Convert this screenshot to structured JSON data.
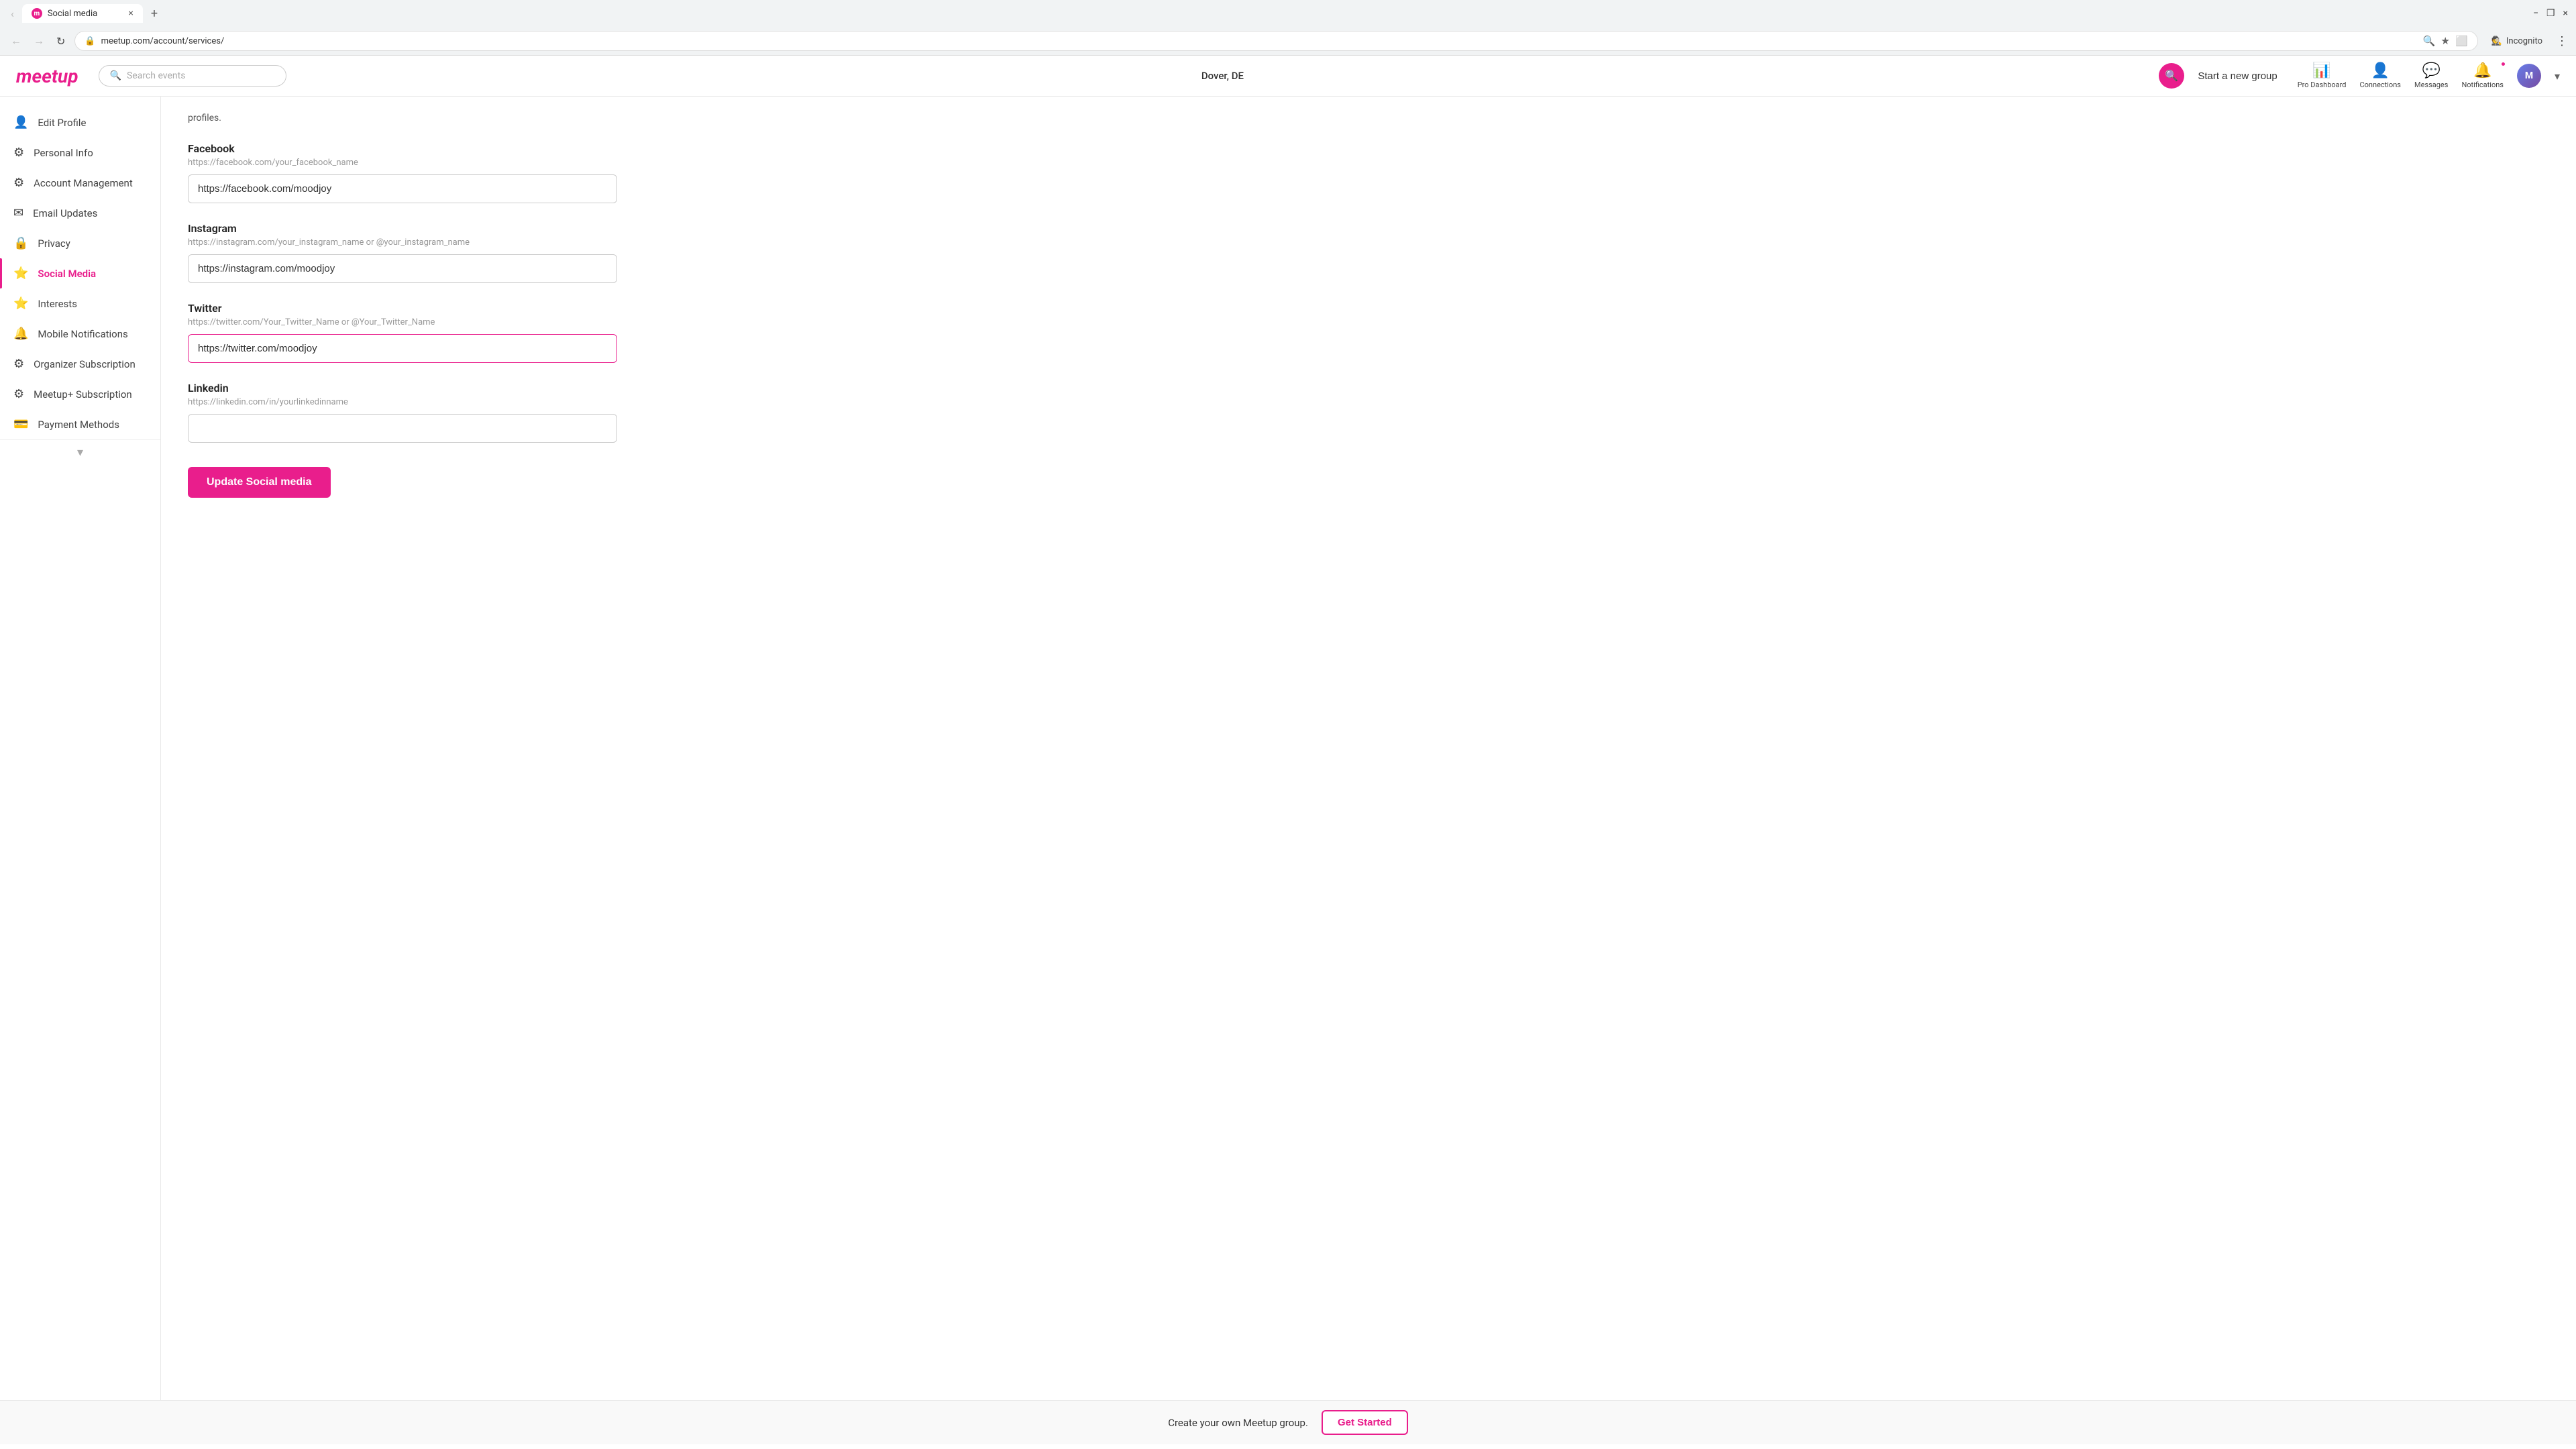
{
  "browser": {
    "tab_title": "Social media",
    "url": "meetup.com/account/services/",
    "tab_close": "×",
    "tab_new": "+",
    "nav_back": "←",
    "nav_forward": "→",
    "nav_refresh": "↻",
    "incognito_label": "Incognito",
    "window_minimize": "−",
    "window_restore": "❐",
    "window_close": "×"
  },
  "navbar": {
    "logo": "meetup",
    "search_placeholder": "Search events",
    "location": "Dover, DE",
    "search_btn_icon": "🔍",
    "start_group": "Start a new group",
    "nav_items": [
      {
        "id": "pro-dashboard",
        "label": "Pro Dashboard",
        "icon": "📊"
      },
      {
        "id": "connections",
        "label": "Connections",
        "icon": "👤"
      },
      {
        "id": "messages",
        "label": "Messages",
        "icon": "💬"
      },
      {
        "id": "notifications",
        "label": "Notifications",
        "icon": "🔔",
        "has_dot": true
      }
    ],
    "avatar_text": "M"
  },
  "sidebar": {
    "items": [
      {
        "id": "edit-profile",
        "label": "Edit Profile",
        "icon": "👤",
        "active": false
      },
      {
        "id": "personal-info",
        "label": "Personal Info",
        "icon": "⚙️",
        "active": false
      },
      {
        "id": "account-management",
        "label": "Account Management",
        "icon": "⚙️",
        "active": false
      },
      {
        "id": "email-updates",
        "label": "Email Updates",
        "icon": "✉️",
        "active": false
      },
      {
        "id": "privacy",
        "label": "Privacy",
        "icon": "🔒",
        "active": false
      },
      {
        "id": "social-media",
        "label": "Social Media",
        "icon": "⭐",
        "active": true
      },
      {
        "id": "interests",
        "label": "Interests",
        "icon": "⭐",
        "active": false
      },
      {
        "id": "mobile-notifications",
        "label": "Mobile Notifications",
        "icon": "🔔",
        "active": false
      },
      {
        "id": "organizer-subscription",
        "label": "Organizer Subscription",
        "icon": "⚙️",
        "active": false
      },
      {
        "id": "meetup-plus",
        "label": "Meetup+ Subscription",
        "icon": "⚙️",
        "active": false
      },
      {
        "id": "payment-methods",
        "label": "Payment Methods",
        "icon": "💳",
        "active": false
      }
    ]
  },
  "page": {
    "intro_text": "profiles.",
    "sections": [
      {
        "id": "facebook",
        "label": "Facebook",
        "hint": "https://facebook.com/your_facebook_name",
        "value": "https://facebook.com/moodjoy",
        "placeholder": "https://facebook.com/your_facebook_name",
        "focused": false
      },
      {
        "id": "instagram",
        "label": "Instagram",
        "hint": "https://instagram.com/your_instagram_name or @your_instagram_name",
        "value": "https://instagram.com/moodjoy",
        "placeholder": "https://instagram.com/your_instagram_name",
        "focused": false
      },
      {
        "id": "twitter",
        "label": "Twitter",
        "hint": "https://twitter.com/Your_Twitter_Name or @Your_Twitter_Name",
        "value": "https://twitter.com/moodjoy",
        "placeholder": "https://twitter.com/Your_Twitter_Name",
        "focused": true
      },
      {
        "id": "linkedin",
        "label": "Linkedin",
        "hint": "https://linkedin.com/in/yourlinkedinname",
        "value": "",
        "placeholder": "",
        "focused": false
      }
    ],
    "update_btn_label": "Update Social media"
  },
  "footer": {
    "text": "Create your own Meetup group.",
    "btn_label": "Get Started"
  }
}
